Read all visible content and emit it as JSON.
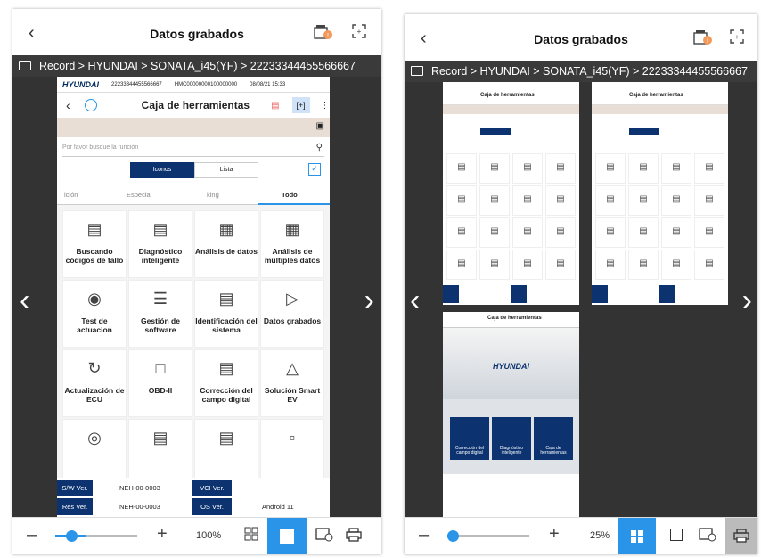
{
  "left": {
    "title": "Datos grabados",
    "breadcrumb": "Record > HYUNDAI > SONATA_i45(YF) > 22233344455566667",
    "device": {
      "brand": "HYUNDAI",
      "hdr_id": "22233344455566667",
      "hdr_hmc": "HMC00000000100000000",
      "hdr_date": "08/08/21 15:33",
      "title": "Caja de herramientas",
      "search_placeholder": "Por favor busque la función",
      "view_icons": "Iconos",
      "view_list": "Lista",
      "tabs": [
        "ición",
        "Especial",
        "king",
        "Todo"
      ],
      "tiles": [
        "Buscando códigos de fallo",
        "Diagnóstico inteligente",
        "Análisis de datos",
        "Análisis de múltiples datos",
        "Test de actuacion",
        "Gestión de software",
        "Identificación del sistema",
        "Datos grabados",
        "Actualización de ECU",
        "OBD-II",
        "Corrección del campo digital",
        "Solución Smart EV",
        "",
        "",
        "",
        ""
      ],
      "footer": {
        "sw_label": "S/W Ver.",
        "sw_value": "NEH-00-0003",
        "vci_label": "VCI Ver.",
        "vci_value": "",
        "res_label": "Res Ver.",
        "res_value": "NEH-00-0003",
        "os_label": "OS Ver.",
        "os_value": "Android 11"
      }
    },
    "zoom": "100%"
  },
  "right": {
    "title": "Datos grabados",
    "breadcrumb": "Record > HYUNDAI > SONATA_i45(YF) > 22233344455566667",
    "thumb_title": "Caja de herramientas",
    "splash_brand": "HYUNDAI",
    "splash_tiles": [
      "Corrección del campo digital",
      "Diagnóstico inteligente",
      "Caja de herramientas"
    ],
    "zoom": "25%"
  },
  "colors": {
    "navy": "#0c3370",
    "accent": "#2a95e8",
    "bar": "#3a3a3a"
  }
}
